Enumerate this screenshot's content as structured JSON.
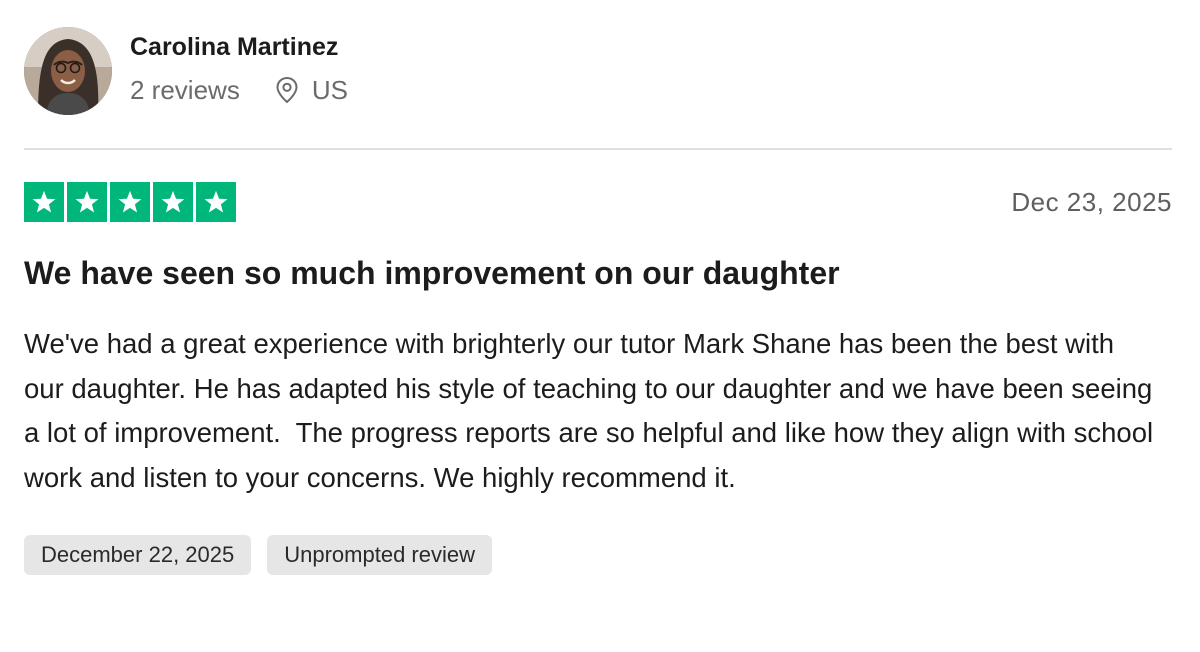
{
  "reviewer": {
    "name": "Carolina Martinez",
    "reviews_count": "2 reviews",
    "location": "US",
    "location_icon": "location-pin-icon"
  },
  "review": {
    "rating": 5,
    "max_rating": 5,
    "star_color": "#00b67a",
    "star_icon": "star-icon",
    "date": "Dec 23, 2025",
    "title": "We have seen so much improvement on our daughter",
    "body": "We've had a great experience with brighterly our tutor Mark Shane has been the best with our daughter. He has adapted his style of teaching to our daughter and we have been seeing a lot of improvement.  The progress reports are so helpful and like how they align with school work and listen to your concerns. We highly recommend it.",
    "tags": {
      "experience_date": "December 22, 2025",
      "review_type": "Unprompted review"
    }
  }
}
